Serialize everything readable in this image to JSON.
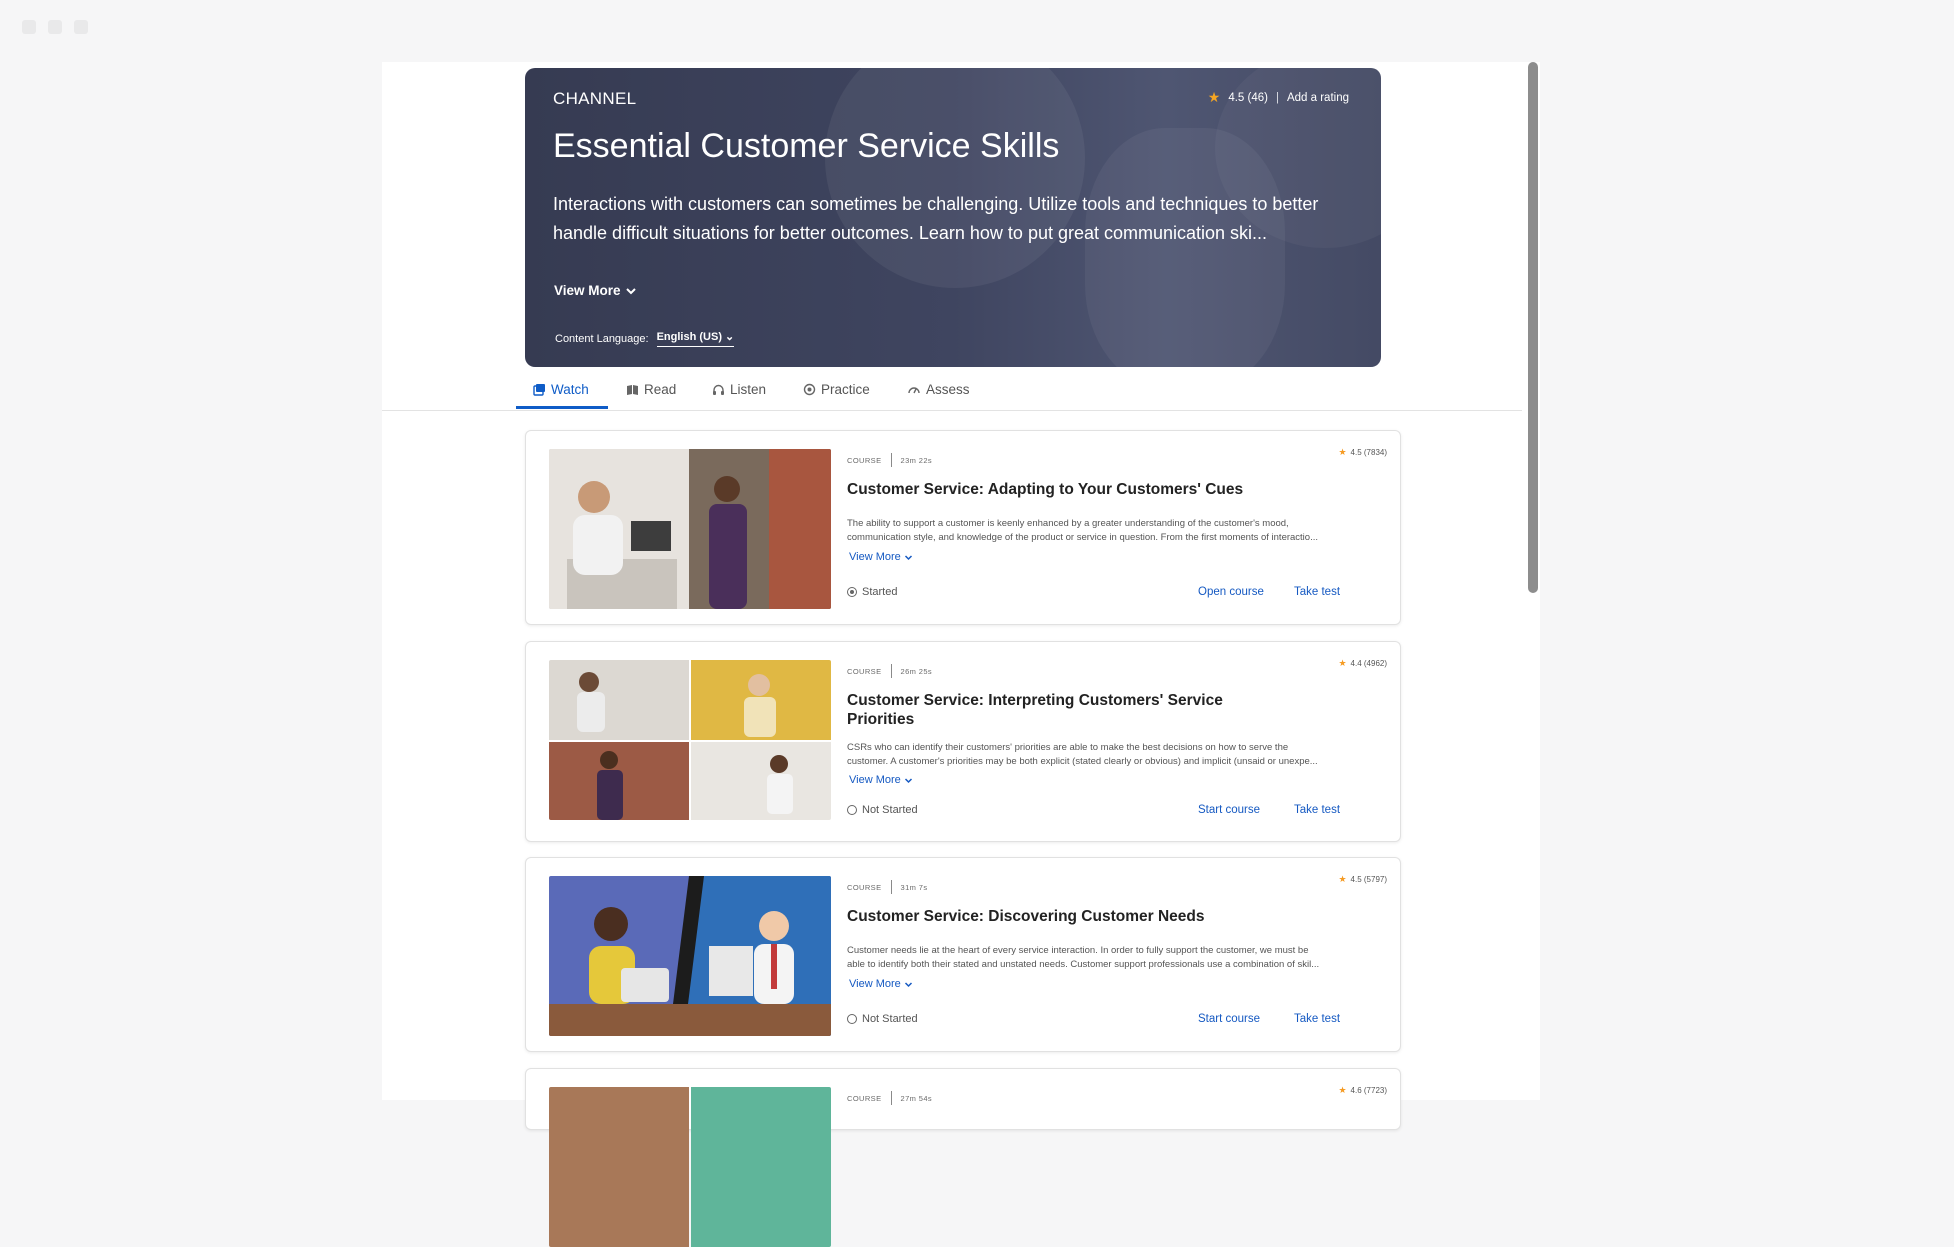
{
  "channel": {
    "label": "CHANNEL",
    "rating": "4.5 (46)",
    "separator": "|",
    "add_rating": "Add a rating",
    "title": "Essential Customer Service Skills",
    "description": "Interactions with customers can sometimes be challenging. Utilize tools and techniques to better handle difficult situations for better outcomes. Learn how to put great communication ski...",
    "view_more": "View More",
    "content_language_label": "Content Language:",
    "content_language_value": "English (US)"
  },
  "tabs": [
    {
      "label": "Watch",
      "icon": "video-icon",
      "active": true
    },
    {
      "label": "Read",
      "icon": "book-icon",
      "active": false
    },
    {
      "label": "Listen",
      "icon": "headphones-icon",
      "active": false
    },
    {
      "label": "Practice",
      "icon": "practice-icon",
      "active": false
    },
    {
      "label": "Assess",
      "icon": "gauge-icon",
      "active": false
    }
  ],
  "courses": [
    {
      "type": "COURSE",
      "duration": "23m 22s",
      "rating": "4.5 (7834)",
      "title": "Customer Service: Adapting to Your Customers' Cues",
      "desc_line1": "The ability to support a customer is keenly enhanced by a greater understanding of the customer's mood,",
      "desc_line2": "communication style, and knowledge of the product or service in question. From the first moments of interactio...",
      "view_more": "View More",
      "status": "Started",
      "primary_action": "Open course",
      "secondary_action": "Take test"
    },
    {
      "type": "COURSE",
      "duration": "26m 25s",
      "rating": "4.4 (4962)",
      "title": "Customer Service: Interpreting Customers' Service Priorities",
      "desc_line1": "CSRs who can identify their customers' priorities are able to make the best decisions on how to serve the",
      "desc_line2": "customer. A customer's priorities may be both explicit (stated clearly or obvious) and implicit (unsaid or unexpe...",
      "view_more": "View More",
      "status": "Not Started",
      "primary_action": "Start course",
      "secondary_action": "Take test"
    },
    {
      "type": "COURSE",
      "duration": "31m 7s",
      "rating": "4.5 (5797)",
      "title": "Customer Service: Discovering Customer Needs",
      "desc_line1": "Customer needs lie at the heart of every service interaction. In order to fully support the customer, we must be",
      "desc_line2": "able to identify both their stated and unstated needs. Customer support professionals use a combination of skil...",
      "view_more": "View More",
      "status": "Not Started",
      "primary_action": "Start course",
      "secondary_action": "Take test"
    },
    {
      "type": "COURSE",
      "duration": "27m 54s",
      "rating": "4.6 (7723)"
    }
  ],
  "colors": {
    "accent": "#0f5cc7",
    "hero_bg": "#3d4360",
    "star": "#f5a623"
  }
}
